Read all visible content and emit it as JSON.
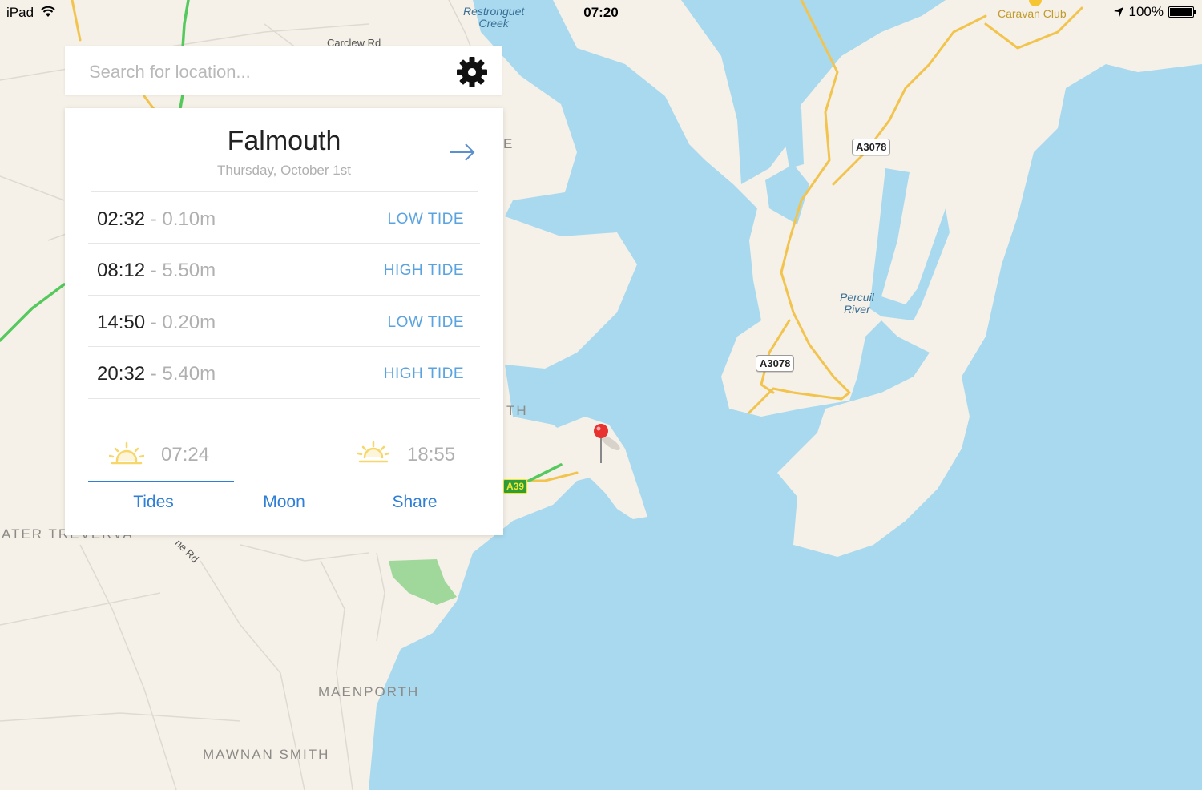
{
  "status_bar": {
    "device": "iPad",
    "time": "07:20",
    "battery": "100%"
  },
  "search": {
    "placeholder": "Search for location..."
  },
  "card": {
    "location": "Falmouth",
    "date": "Thursday, October 1st",
    "tides": [
      {
        "time": "02:32",
        "height": "- 0.10m",
        "type": "LOW TIDE"
      },
      {
        "time": "08:12",
        "height": "- 5.50m",
        "type": "HIGH TIDE"
      },
      {
        "time": "14:50",
        "height": "- 0.20m",
        "type": "LOW TIDE"
      },
      {
        "time": "20:32",
        "height": "- 5.40m",
        "type": "HIGH TIDE"
      }
    ],
    "sunrise": "07:24",
    "sunset": "18:55",
    "tabs": [
      "Tides",
      "Moon",
      "Share"
    ],
    "active_tab": "Tides"
  },
  "map": {
    "labels": {
      "restronguet": "Restronguet\nCreek",
      "carclew": "Carclew Rd",
      "caravan": "Caravan Club",
      "percuil": "Percuil\nRiver",
      "a3078_top": "A3078",
      "a3078_bottom": "A3078",
      "a39": "A39",
      "th": "TH",
      "e": "E",
      "ater": "ATER TREVERVA",
      "ne_rd": "ne Rd",
      "maenporth": "MAENPORTH",
      "mawnan": "MAWNAN SMITH"
    },
    "colors": {
      "water": "#a8d9ef",
      "land": "#f5f1e8",
      "road_major": "#f2c44d",
      "road_green": "#55c95d",
      "park": "#9fd89a",
      "pin": "#e8322f"
    }
  }
}
